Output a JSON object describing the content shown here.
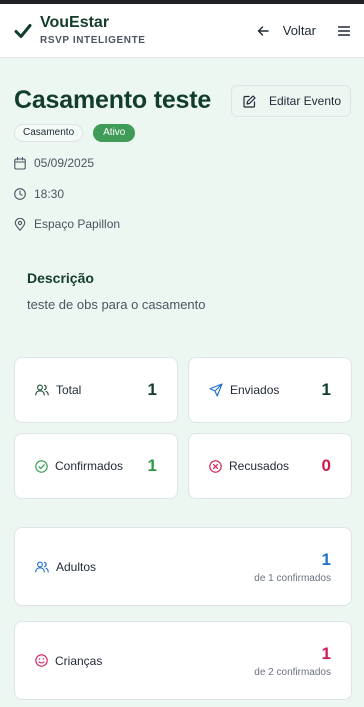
{
  "header": {
    "brand_name": "VouEstar",
    "brand_sub": "RSVP INTELIGENTE",
    "back_label": "Voltar"
  },
  "event": {
    "title": "Casamento teste",
    "edit_label": "Editar Evento",
    "type_tag": "Casamento",
    "status_tag": "Ativo",
    "date": "05/09/2025",
    "time": "18:30",
    "location": "Espaço Papillon"
  },
  "description": {
    "title": "Descrição",
    "text": "teste de obs para o casamento"
  },
  "stats": {
    "total": {
      "label": "Total",
      "value": "1"
    },
    "sent": {
      "label": "Enviados",
      "value": "1"
    },
    "confirmed": {
      "label": "Confirmados",
      "value": "1"
    },
    "refused": {
      "label": "Recusados",
      "value": "0"
    }
  },
  "breakdown": {
    "adults": {
      "label": "Adultos",
      "value": "1",
      "sub": "de 1 confirmados"
    },
    "children": {
      "label": "Crianças",
      "value": "1",
      "sub": "de 2 confirmados"
    }
  },
  "colors": {
    "brand_green": "#123d2a",
    "accent_green": "#3f9b58",
    "confirmed_green": "#2e9a48",
    "refused_red": "#d0194a",
    "adults_blue": "#1f6fd1",
    "children_pink": "#d0195e"
  }
}
